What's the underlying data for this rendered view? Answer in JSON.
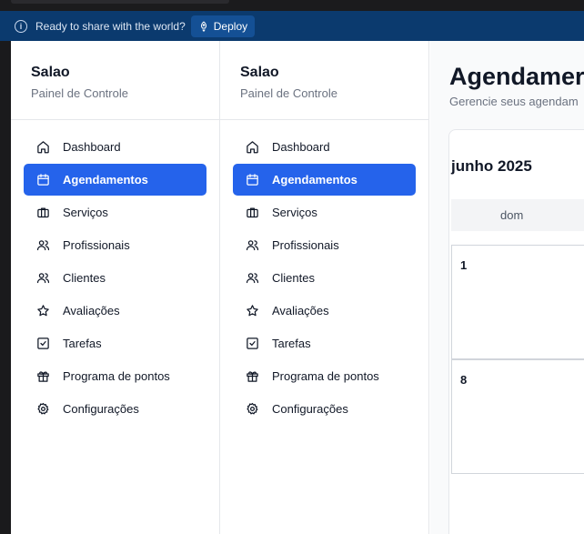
{
  "banner": {
    "message": "Ready to share with the world?",
    "deploy_label": "Deploy"
  },
  "sidebars": [
    {
      "title": "Salao",
      "subtitle": "Painel de Controle",
      "items": [
        {
          "label": "Dashboard",
          "icon": "home-icon",
          "active": false
        },
        {
          "label": "Agendamentos",
          "icon": "calendar-icon",
          "active": true
        },
        {
          "label": "Serviços",
          "icon": "briefcase-icon",
          "active": false
        },
        {
          "label": "Profissionais",
          "icon": "users-icon",
          "active": false
        },
        {
          "label": "Clientes",
          "icon": "users-icon",
          "active": false
        },
        {
          "label": "Avaliações",
          "icon": "star-icon",
          "active": false
        },
        {
          "label": "Tarefas",
          "icon": "checkbox-icon",
          "active": false
        },
        {
          "label": "Programa de pontos",
          "icon": "gift-icon",
          "active": false
        },
        {
          "label": "Configurações",
          "icon": "gear-icon",
          "active": false
        }
      ]
    },
    {
      "title": "Salao",
      "subtitle": "Painel de Controle",
      "items": [
        {
          "label": "Dashboard",
          "icon": "home-icon",
          "active": false
        },
        {
          "label": "Agendamentos",
          "icon": "calendar-icon",
          "active": true
        },
        {
          "label": "Serviços",
          "icon": "briefcase-icon",
          "active": false
        },
        {
          "label": "Profissionais",
          "icon": "users-icon",
          "active": false
        },
        {
          "label": "Clientes",
          "icon": "users-icon",
          "active": false
        },
        {
          "label": "Avaliações",
          "icon": "star-icon",
          "active": false
        },
        {
          "label": "Tarefas",
          "icon": "checkbox-icon",
          "active": false
        },
        {
          "label": "Programa de pontos",
          "icon": "gift-icon",
          "active": false
        },
        {
          "label": "Configurações",
          "icon": "gear-icon",
          "active": false
        }
      ]
    }
  ],
  "main": {
    "title": "Agendamer",
    "subtitle": "Gerencie seus agendam",
    "calendar": {
      "month_label": "junho 2025",
      "weekday_header": "dom",
      "week_start_days": [
        "1",
        "8"
      ]
    }
  },
  "colors": {
    "accent": "#2563eb",
    "banner": "#0b3a6e"
  }
}
